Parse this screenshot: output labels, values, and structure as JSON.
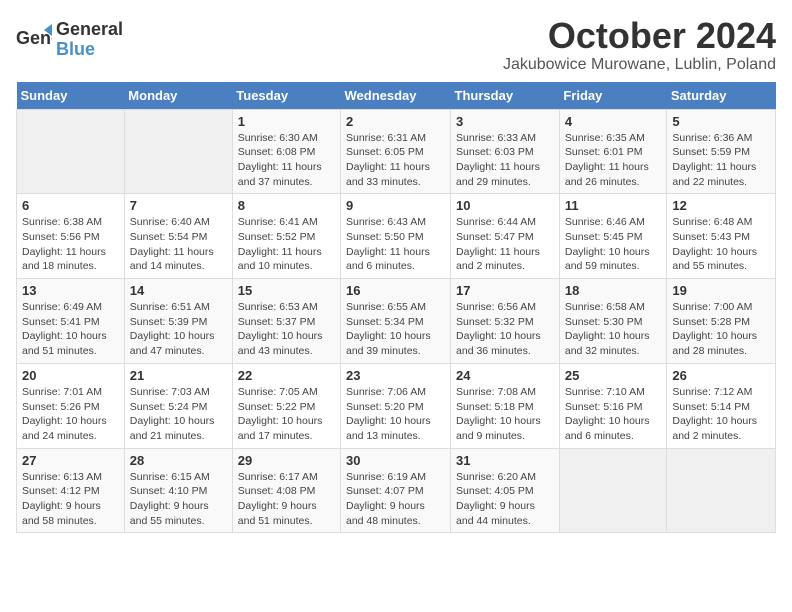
{
  "logo": {
    "line1": "General",
    "line2": "Blue"
  },
  "title": "October 2024",
  "subtitle": "Jakubowice Murowane, Lublin, Poland",
  "days_of_week": [
    "Sunday",
    "Monday",
    "Tuesday",
    "Wednesday",
    "Thursday",
    "Friday",
    "Saturday"
  ],
  "weeks": [
    [
      {
        "day": "",
        "info": ""
      },
      {
        "day": "",
        "info": ""
      },
      {
        "day": "1",
        "info": "Sunrise: 6:30 AM\nSunset: 6:08 PM\nDaylight: 11 hours and 37 minutes."
      },
      {
        "day": "2",
        "info": "Sunrise: 6:31 AM\nSunset: 6:05 PM\nDaylight: 11 hours and 33 minutes."
      },
      {
        "day": "3",
        "info": "Sunrise: 6:33 AM\nSunset: 6:03 PM\nDaylight: 11 hours and 29 minutes."
      },
      {
        "day": "4",
        "info": "Sunrise: 6:35 AM\nSunset: 6:01 PM\nDaylight: 11 hours and 26 minutes."
      },
      {
        "day": "5",
        "info": "Sunrise: 6:36 AM\nSunset: 5:59 PM\nDaylight: 11 hours and 22 minutes."
      }
    ],
    [
      {
        "day": "6",
        "info": "Sunrise: 6:38 AM\nSunset: 5:56 PM\nDaylight: 11 hours and 18 minutes."
      },
      {
        "day": "7",
        "info": "Sunrise: 6:40 AM\nSunset: 5:54 PM\nDaylight: 11 hours and 14 minutes."
      },
      {
        "day": "8",
        "info": "Sunrise: 6:41 AM\nSunset: 5:52 PM\nDaylight: 11 hours and 10 minutes."
      },
      {
        "day": "9",
        "info": "Sunrise: 6:43 AM\nSunset: 5:50 PM\nDaylight: 11 hours and 6 minutes."
      },
      {
        "day": "10",
        "info": "Sunrise: 6:44 AM\nSunset: 5:47 PM\nDaylight: 11 hours and 2 minutes."
      },
      {
        "day": "11",
        "info": "Sunrise: 6:46 AM\nSunset: 5:45 PM\nDaylight: 10 hours and 59 minutes."
      },
      {
        "day": "12",
        "info": "Sunrise: 6:48 AM\nSunset: 5:43 PM\nDaylight: 10 hours and 55 minutes."
      }
    ],
    [
      {
        "day": "13",
        "info": "Sunrise: 6:49 AM\nSunset: 5:41 PM\nDaylight: 10 hours and 51 minutes."
      },
      {
        "day": "14",
        "info": "Sunrise: 6:51 AM\nSunset: 5:39 PM\nDaylight: 10 hours and 47 minutes."
      },
      {
        "day": "15",
        "info": "Sunrise: 6:53 AM\nSunset: 5:37 PM\nDaylight: 10 hours and 43 minutes."
      },
      {
        "day": "16",
        "info": "Sunrise: 6:55 AM\nSunset: 5:34 PM\nDaylight: 10 hours and 39 minutes."
      },
      {
        "day": "17",
        "info": "Sunrise: 6:56 AM\nSunset: 5:32 PM\nDaylight: 10 hours and 36 minutes."
      },
      {
        "day": "18",
        "info": "Sunrise: 6:58 AM\nSunset: 5:30 PM\nDaylight: 10 hours and 32 minutes."
      },
      {
        "day": "19",
        "info": "Sunrise: 7:00 AM\nSunset: 5:28 PM\nDaylight: 10 hours and 28 minutes."
      }
    ],
    [
      {
        "day": "20",
        "info": "Sunrise: 7:01 AM\nSunset: 5:26 PM\nDaylight: 10 hours and 24 minutes."
      },
      {
        "day": "21",
        "info": "Sunrise: 7:03 AM\nSunset: 5:24 PM\nDaylight: 10 hours and 21 minutes."
      },
      {
        "day": "22",
        "info": "Sunrise: 7:05 AM\nSunset: 5:22 PM\nDaylight: 10 hours and 17 minutes."
      },
      {
        "day": "23",
        "info": "Sunrise: 7:06 AM\nSunset: 5:20 PM\nDaylight: 10 hours and 13 minutes."
      },
      {
        "day": "24",
        "info": "Sunrise: 7:08 AM\nSunset: 5:18 PM\nDaylight: 10 hours and 9 minutes."
      },
      {
        "day": "25",
        "info": "Sunrise: 7:10 AM\nSunset: 5:16 PM\nDaylight: 10 hours and 6 minutes."
      },
      {
        "day": "26",
        "info": "Sunrise: 7:12 AM\nSunset: 5:14 PM\nDaylight: 10 hours and 2 minutes."
      }
    ],
    [
      {
        "day": "27",
        "info": "Sunrise: 6:13 AM\nSunset: 4:12 PM\nDaylight: 9 hours and 58 minutes."
      },
      {
        "day": "28",
        "info": "Sunrise: 6:15 AM\nSunset: 4:10 PM\nDaylight: 9 hours and 55 minutes."
      },
      {
        "day": "29",
        "info": "Sunrise: 6:17 AM\nSunset: 4:08 PM\nDaylight: 9 hours and 51 minutes."
      },
      {
        "day": "30",
        "info": "Sunrise: 6:19 AM\nSunset: 4:07 PM\nDaylight: 9 hours and 48 minutes."
      },
      {
        "day": "31",
        "info": "Sunrise: 6:20 AM\nSunset: 4:05 PM\nDaylight: 9 hours and 44 minutes."
      },
      {
        "day": "",
        "info": ""
      },
      {
        "day": "",
        "info": ""
      }
    ]
  ]
}
